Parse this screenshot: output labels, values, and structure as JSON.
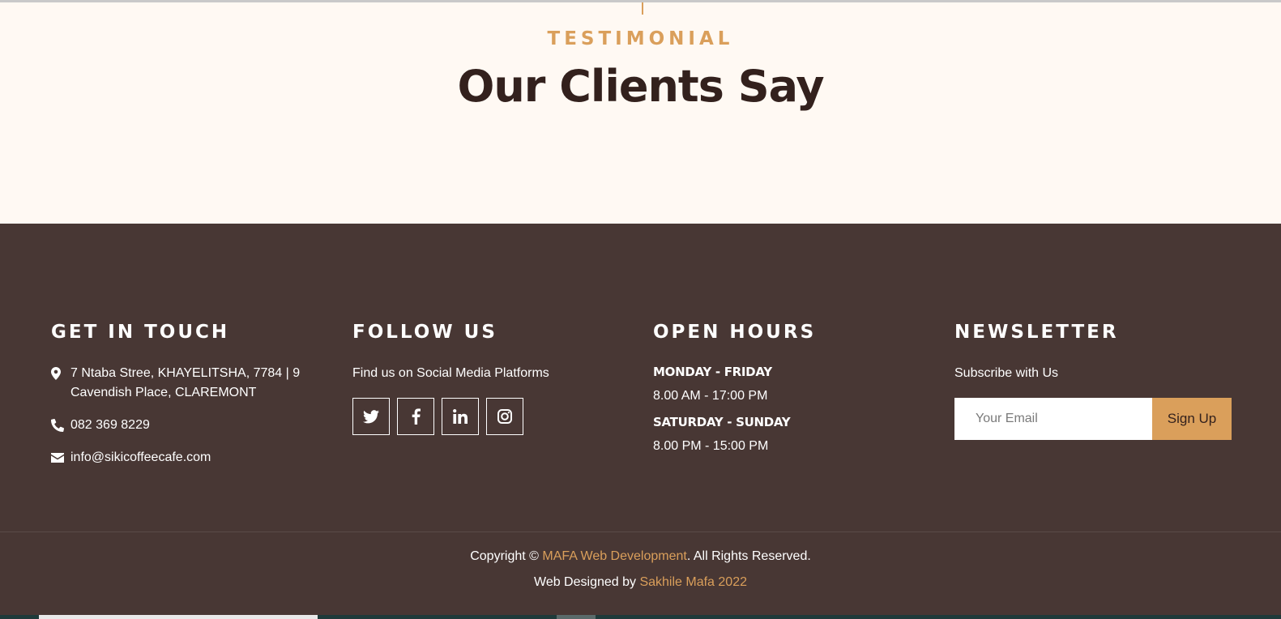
{
  "testimonial": {
    "eyebrow": "TESTIMONIAL",
    "title": "Our Clients Say"
  },
  "footer": {
    "contact": {
      "heading": "GET IN TOUCH",
      "address": "7 Ntaba Stree, KHAYELITSHA, 7784 | 9 Cavendish Place, CLAREMONT",
      "phone": "082 369 8229",
      "email": "info@sikicoffeecafe.com"
    },
    "follow": {
      "heading": "FOLLOW US",
      "text": "Find us on Social Media Platforms",
      "socials": [
        "twitter-icon",
        "facebook-icon",
        "linkedin-icon",
        "instagram-icon"
      ]
    },
    "hours": {
      "heading": "OPEN HOURS",
      "weekday_label": "MONDAY - FRIDAY",
      "weekday_time": "8.00 AM - 17:00 PM",
      "weekend_label": "SATURDAY - SUNDAY",
      "weekend_time": "8.00 PM - 15:00 PM"
    },
    "newsletter": {
      "heading": "NEWSLETTER",
      "text": "Subscribe with Us",
      "email_placeholder": "Your Email",
      "email_value": "",
      "button_label": "Sign Up"
    },
    "copyright": {
      "prefix": "Copyright © ",
      "company": "MAFA Web Development",
      "suffix": ". All Rights Reserved."
    },
    "designed": {
      "prefix": "Web Designed by ",
      "designer": "Sakhile Mafa 2022"
    }
  },
  "colors": {
    "accent": "#da9f5b",
    "footer_bg": "#483734",
    "section_bg": "#fff9f3",
    "heading_dark": "#33211d"
  }
}
